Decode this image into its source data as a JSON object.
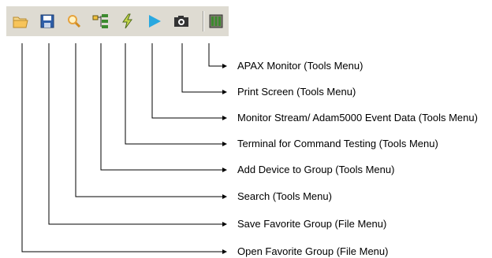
{
  "toolbar": {
    "buttons": [
      {
        "id": "open",
        "icon": "open-folder-icon",
        "color": "#e8b04a"
      },
      {
        "id": "save",
        "icon": "floppy-disk-icon",
        "color": "#2f5fa8"
      },
      {
        "id": "search",
        "icon": "magnifier-icon",
        "color": "#e6a23c"
      },
      {
        "id": "add-device",
        "icon": "device-tree-icon",
        "color": "#3c8a2e"
      },
      {
        "id": "terminal",
        "icon": "lightning-bolt-icon",
        "color": "#6b8e23"
      },
      {
        "id": "monitor-stream",
        "icon": "play-arrow-icon",
        "color": "#29a8e0"
      },
      {
        "id": "print-screen",
        "icon": "camera-icon",
        "color": "#333333"
      },
      {
        "id": "apax-monitor",
        "icon": "apax-module-icon",
        "color": "#5a6b3a"
      }
    ]
  },
  "callouts": [
    "APAX Monitor (Tools Menu)",
    "Print Screen (Tools Menu)",
    "Monitor Stream/ Adam5000 Event Data (Tools Menu)",
    "Terminal for Command Testing (Tools Menu)",
    "Add Device to Group (Tools Menu)",
    "Search (Tools Menu)",
    "Save Favorite Group (File Menu)",
    "Open Favorite Group (File Menu)"
  ]
}
